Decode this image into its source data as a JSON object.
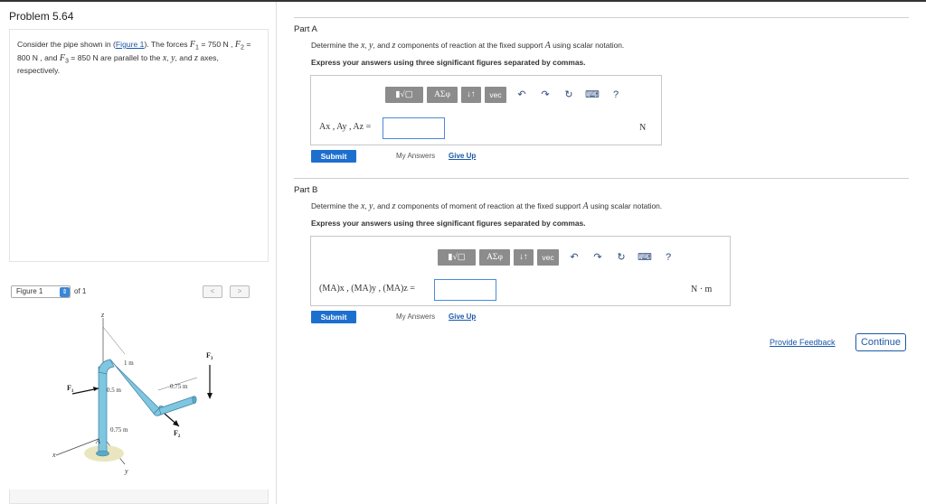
{
  "problem": {
    "title": "Problem 5.64",
    "statement_parts": [
      "Consider the pipe shown in (",
      "Figure 1",
      "). The forces ",
      "F",
      "1",
      " = 750 N , ",
      "F",
      "2",
      " = 800 N , and ",
      "F",
      "3",
      " = 850 N are parallel to the ",
      "x",
      ", ",
      "y",
      ", and ",
      "z",
      " axes, respectively."
    ]
  },
  "figure_nav": {
    "selected": "Figure 1",
    "of_label": "of 1",
    "prev": "<",
    "next": ">"
  },
  "figure": {
    "labels": {
      "z": "z",
      "x": "x",
      "y": "y",
      "a": "A",
      "f1": "F",
      "f1_sub": "1",
      "f2": "F",
      "f2_sub": "2",
      "f3": "F",
      "f3_sub": "3",
      "dim_1m": "1 m",
      "dim_05m": "0.5 m",
      "dim_075m_top": "0.75 m",
      "dim_075m_bottom": "0.75 m"
    }
  },
  "parts": [
    {
      "label": "Part A",
      "instruction_parts": [
        "Determine the ",
        "x",
        ", ",
        "y",
        ", and ",
        "z",
        " components of reaction at the fixed support ",
        "A",
        " using scalar notation."
      ],
      "format_note": "Express your answers using three significant figures separated by commas.",
      "answer_label": "Ax , Ay , Az =",
      "answer_value": "",
      "unit": "N",
      "submit": "Submit",
      "my_answers": "My Answers",
      "give_up": "Give Up"
    },
    {
      "label": "Part B",
      "instruction_parts": [
        "Determine the ",
        "x",
        ", ",
        "y",
        ", and ",
        "z",
        " components of moment of reaction at the fixed support ",
        "A",
        " using scalar notation."
      ],
      "format_note": "Express your answers using three significant figures separated by commas.",
      "answer_label": "(MA)x , (MA)y , (MA)z =",
      "answer_value": "",
      "unit": "N · m",
      "submit": "Submit",
      "my_answers": "My Answers",
      "give_up": "Give Up"
    }
  ],
  "toolbar": {
    "templates": "▮√▢",
    "greek": "ΑΣφ",
    "arrows": "↓↑",
    "vec": "vec",
    "undo_icon": "undo-icon",
    "redo_icon": "redo-icon",
    "reset_icon": "reset-icon",
    "keyboard_icon": "keyboard-icon",
    "help": "?"
  },
  "footer": {
    "provide_feedback": "Provide Feedback",
    "continue": "Continue"
  },
  "colors": {
    "accent": "#1d6fce",
    "toolbar_button": "#8c8c8c",
    "link": "#1a57a8",
    "pipe": "#7fc6e0"
  }
}
